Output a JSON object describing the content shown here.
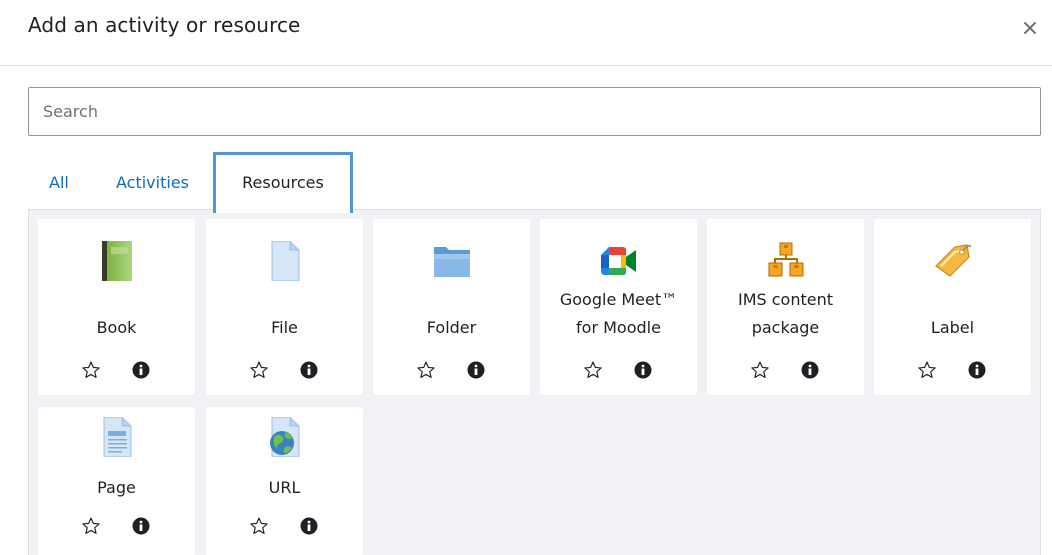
{
  "modal": {
    "title": "Add an activity or resource",
    "close_icon": "close-icon"
  },
  "search": {
    "placeholder": "Search",
    "value": ""
  },
  "tabs": [
    {
      "label": "All",
      "active": false
    },
    {
      "label": "Activities",
      "active": false
    },
    {
      "label": "Resources",
      "active": true
    }
  ],
  "colors": {
    "link": "#0f6cbf",
    "active_tab_border": "#5694cf",
    "panel_bg": "#f0f2f5",
    "text": "#1d2125"
  },
  "resources": [
    {
      "name_lines": [
        "Book"
      ],
      "icon": "book-icon"
    },
    {
      "name_lines": [
        "File"
      ],
      "icon": "file-icon"
    },
    {
      "name_lines": [
        "Folder"
      ],
      "icon": "folder-icon"
    },
    {
      "name_lines": [
        "Google Meet™",
        "for Moodle"
      ],
      "icon": "google-meet-icon"
    },
    {
      "name_lines": [
        "IMS content",
        "package"
      ],
      "icon": "ims-package-icon"
    },
    {
      "name_lines": [
        "Label"
      ],
      "icon": "label-tag-icon"
    },
    {
      "name_lines": [
        "Page"
      ],
      "icon": "page-icon"
    },
    {
      "name_lines": [
        "URL"
      ],
      "icon": "url-globe-icon"
    }
  ],
  "card_actions": {
    "star_icon": "star-outline-icon",
    "info_icon": "info-circle-icon"
  }
}
